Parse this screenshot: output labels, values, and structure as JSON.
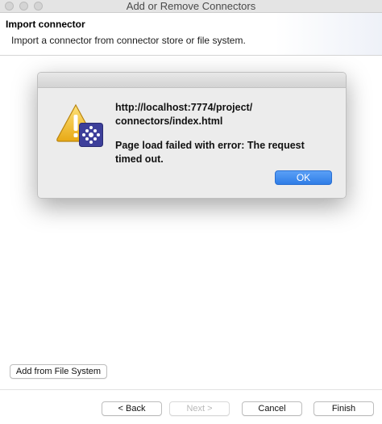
{
  "window": {
    "title": "Add or Remove Connectors"
  },
  "header": {
    "title": "Import connector",
    "description": "Import a connector from connector store or file system."
  },
  "buttons": {
    "add_from_fs": "Add from File System",
    "back": "< Back",
    "next": "Next >",
    "cancel": "Cancel",
    "finish": "Finish"
  },
  "dialog": {
    "url_line1": "http://localhost:7774/project/",
    "url_line2": "connectors/index.html",
    "error_line1": "Page load failed with error: The request",
    "error_line2": "timed out.",
    "ok_label": "OK",
    "icon": "warning-icon",
    "badge_icon": "app-badge-icon"
  },
  "colors": {
    "ok_button": "#2f7de6",
    "warning": "#f2c12e"
  }
}
